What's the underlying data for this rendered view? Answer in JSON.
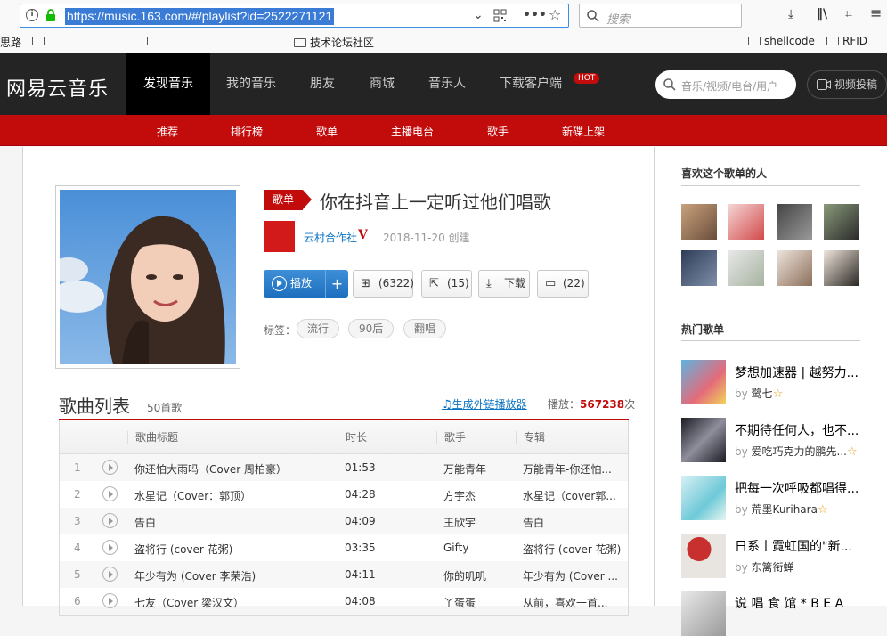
{
  "browser": {
    "url": "https://music.163.com/#/playlist?id=2522271121",
    "search_placeholder": "搜索",
    "bookmarks": [
      "思路",
      "技术论坛社区",
      "shellcode",
      "RFID"
    ]
  },
  "site": {
    "logo": "网易云音乐",
    "nav": [
      "发现音乐",
      "我的音乐",
      "朋友",
      "商城",
      "音乐人",
      "下载客户端"
    ],
    "hot_badge": "HOT",
    "search_placeholder": "音乐/视频/电台/用户",
    "upload_label": "视频投稿",
    "subnav": [
      "推荐",
      "排行榜",
      "歌单",
      "主播电台",
      "歌手",
      "新碟上架"
    ]
  },
  "playlist": {
    "badge": "歌单",
    "title": "你在抖音上一定听过他们唱歌",
    "creator": "云村合作社",
    "creator_badge": "V",
    "created": "2018-11-20 创建",
    "play_label": "播放",
    "plus_label": "+",
    "collect_count": "(6322)",
    "share_count": "(15)",
    "download_label": "下载",
    "comment_count": "(22)",
    "tags_label": "标签：",
    "tags": [
      "流行",
      "90后",
      "翻唱"
    ]
  },
  "song_list": {
    "title": "歌曲列表",
    "count": "50首歌",
    "outer_player": "生成外链播放器",
    "play_label": "播放：",
    "play_count": "567238",
    "play_unit": "次",
    "columns": [
      "歌曲标题",
      "时长",
      "歌手",
      "专辑"
    ],
    "rows": [
      {
        "idx": "1",
        "title": "你还怕大雨吗（Cover 周柏豪）",
        "time": "01:53",
        "artist": "万能青年",
        "album": "万能青年-你还怕..."
      },
      {
        "idx": "2",
        "title": "水星记（Cover：郭顶）",
        "time": "04:28",
        "artist": "方宇杰",
        "album": "水星记（cover郭..."
      },
      {
        "idx": "3",
        "title": "告白",
        "time": "04:09",
        "artist": "王欣宇",
        "album": "告白"
      },
      {
        "idx": "4",
        "title": "盗将行 (cover 花粥)",
        "time": "03:35",
        "artist": "Gifty",
        "album": "盗将行 (cover 花粥)"
      },
      {
        "idx": "5",
        "title": "年少有为 (Cover 李荣浩)",
        "time": "04:11",
        "artist": "你的叽叽",
        "album": "年少有为 (Cover ..."
      },
      {
        "idx": "6",
        "title": "七友（Cover 梁汉文）",
        "time": "04:08",
        "artist": "丫蛋蛋",
        "album": "从前，喜欢一首..."
      }
    ]
  },
  "sidebar": {
    "fans_title": "喜欢这个歌单的人",
    "hot_title": "热门歌单",
    "hot_playlists": [
      {
        "name": "梦想加速器 | 越努力...",
        "by": "by",
        "user": "鹭七",
        "star": true
      },
      {
        "name": "不期待任何人，也不...",
        "by": "by",
        "user": "爱吃巧克力的鹏先...",
        "star": true
      },
      {
        "name": "把每一次呼吸都唱得...",
        "by": "by",
        "user": "荒墨Kurihara",
        "star": true
      },
      {
        "name": "日系丨霓虹国的\"新...",
        "by": "by",
        "user": "东篱衔蝉",
        "star": false
      },
      {
        "name": "说 唱 食 馆 * B E A",
        "by": "",
        "user": "",
        "star": false
      }
    ]
  }
}
